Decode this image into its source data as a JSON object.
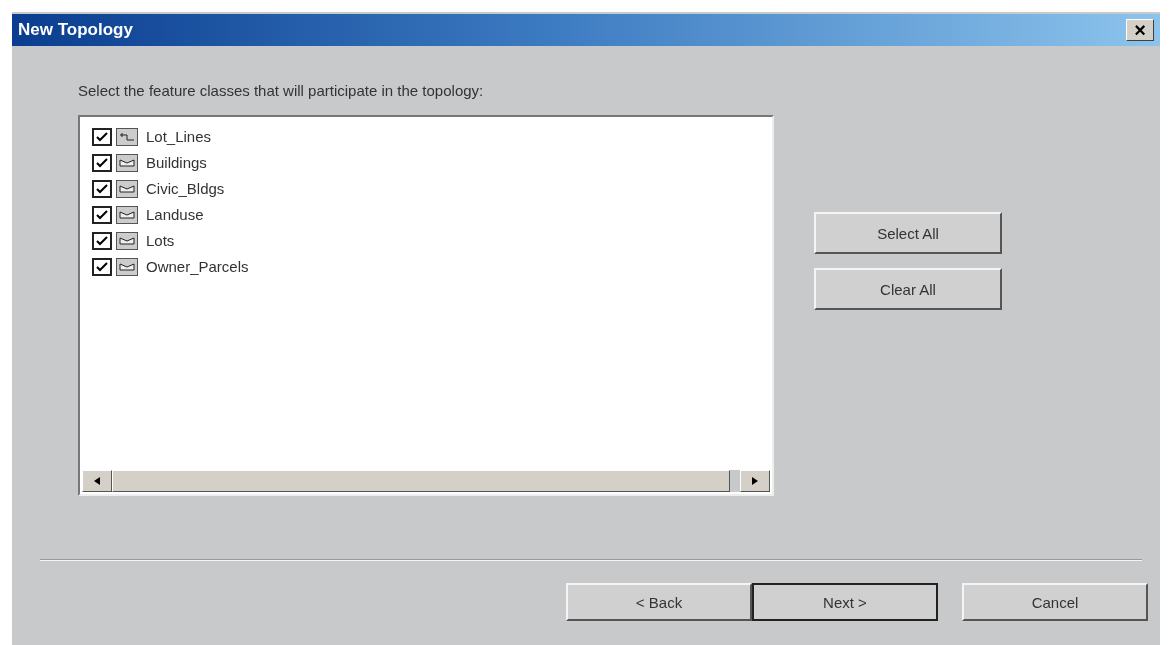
{
  "window": {
    "title": "New Topology",
    "close": "×"
  },
  "instruction": "Select the feature classes that will participate in the topology:",
  "feature_classes": [
    {
      "label": "Lot_Lines",
      "kind": "line",
      "checked": true
    },
    {
      "label": "Buildings",
      "kind": "polygon",
      "checked": true
    },
    {
      "label": "Civic_Bldgs",
      "kind": "polygon",
      "checked": true
    },
    {
      "label": "Landuse",
      "kind": "polygon",
      "checked": true
    },
    {
      "label": "Lots",
      "kind": "polygon",
      "checked": true
    },
    {
      "label": "Owner_Parcels",
      "kind": "polygon",
      "checked": true
    }
  ],
  "side_buttons": [
    "Select All",
    "Clear All"
  ],
  "footer_buttons": [
    {
      "label": "< Back",
      "default": false
    },
    {
      "label": "Next >",
      "default": true
    },
    {
      "label": "Cancel",
      "default": false
    }
  ]
}
